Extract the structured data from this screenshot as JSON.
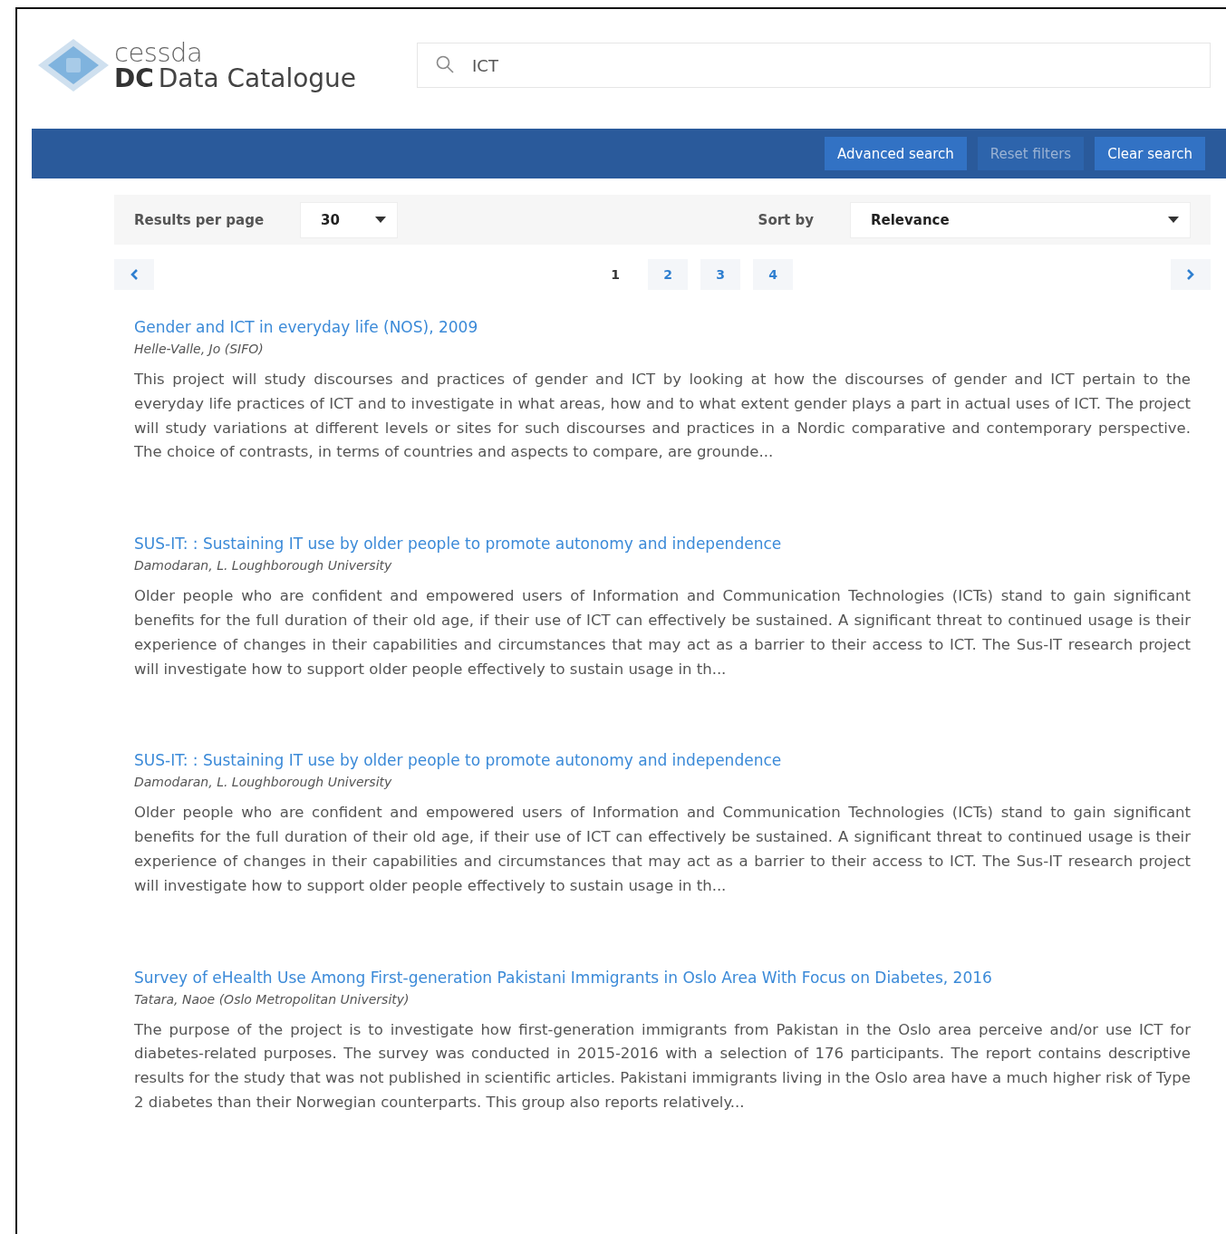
{
  "logo": {
    "top": "cessda",
    "initials": "DC",
    "name": "Data Catalogue"
  },
  "search": {
    "value": "ICT"
  },
  "toolbar_buttons": [
    {
      "label": "Advanced search",
      "disabled": false
    },
    {
      "label": "Reset filters",
      "disabled": true
    },
    {
      "label": "Clear search",
      "disabled": false
    }
  ],
  "results_per_page": {
    "label": "Results per page",
    "value": "30"
  },
  "sort_by": {
    "label": "Sort by",
    "value": "Relevance"
  },
  "pagination": {
    "pages": [
      {
        "label": "1",
        "selected": true
      },
      {
        "label": "2",
        "selected": false
      },
      {
        "label": "3",
        "selected": false
      },
      {
        "label": "4",
        "selected": false
      }
    ]
  },
  "results": [
    {
      "title": "Gender and ICT in everyday life (NOS), 2009",
      "creator": "Helle-Valle, Jo (SIFO)",
      "abstract": "This project will study discourses and practices of gender and ICT by looking at how the discourses of gender and ICT pertain to the everyday life practices of ICT and to investigate in what areas, how and to what extent gender plays a part in actual uses of ICT. The project will study variations at different levels or sites for such discourses and practices in a Nordic comparative and contemporary perspective. The choice of contrasts, in terms of countries and aspects to compare, are grounde..."
    },
    {
      "title": "SUS-IT: : Sustaining IT use by older people to promote autonomy and independence",
      "creator": "Damodaran, L. Loughborough University",
      "abstract": "Older people who are confident and empowered users of Information and Communication Technologies (ICTs) stand to gain significant benefits for the full duration of their old age, if their use of ICT can effectively be sustained. A significant threat to continued usage is their experience of changes in their capabilities and circumstances that may act as a barrier to their access to ICT. The Sus-IT research project will investigate how to support older people effectively to sustain usage in th..."
    },
    {
      "title": "SUS-IT: : Sustaining IT use by older people to promote autonomy and independence",
      "creator": "Damodaran, L. Loughborough University",
      "abstract": "Older people who are confident and empowered users of Information and Communication Technologies (ICTs) stand to gain significant benefits for the full duration of their old age, if their use of ICT can effectively be sustained. A significant threat to continued usage is their experience of changes in their capabilities and circumstances that may act as a barrier to their access to ICT. The Sus-IT research project will investigate how to support older people effectively to sustain usage in th..."
    },
    {
      "title": "Survey of eHealth Use Among First-generation Pakistani Immigrants in Oslo Area With Focus on Diabetes, 2016",
      "creator": "Tatara, Naoe (Oslo Metropolitan University)",
      "abstract": "The purpose of the project is to investigate how first-generation immigrants from Pakistan in the Oslo area perceive and/or use ICT for diabetes-related purposes. The survey was conducted in 2015-2016 with a selection of 176 participants. The report contains descriptive results for the study that was not published in scientific articles. Pakistani immigrants living in the Oslo area have a much higher risk of Type 2 diabetes than their Norwegian counterparts. This group also reports relatively..."
    }
  ]
}
